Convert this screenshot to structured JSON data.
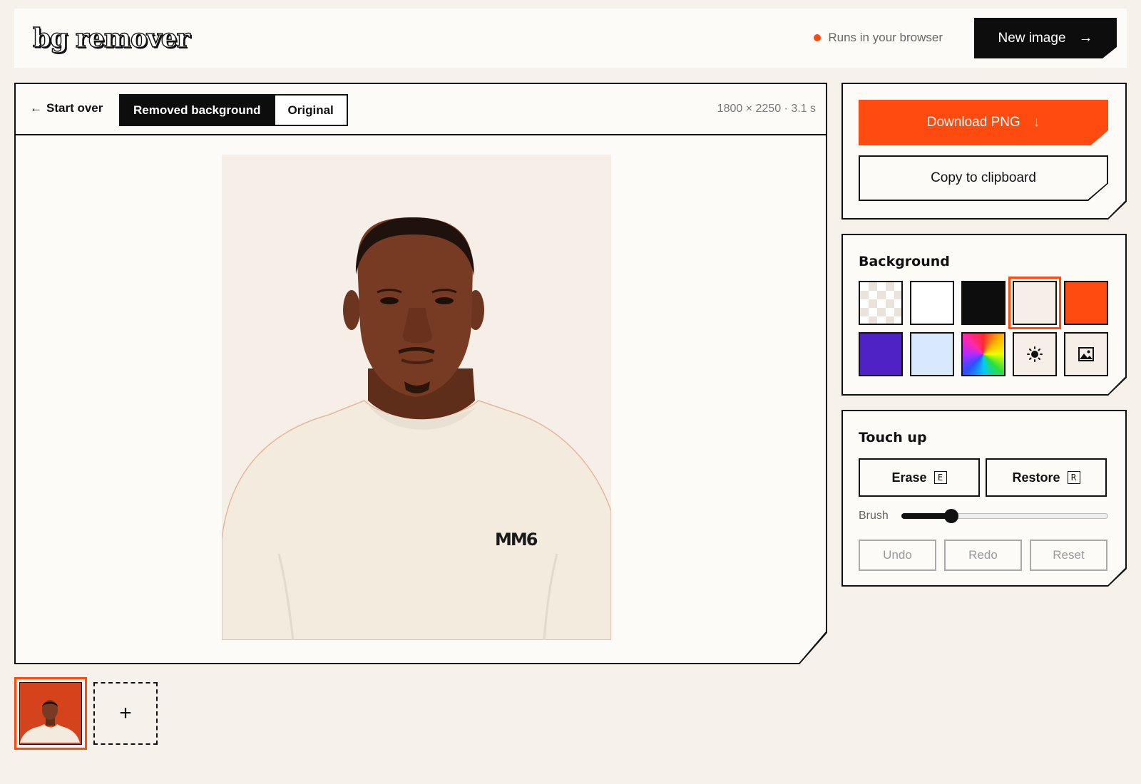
{
  "header": {
    "logo": "bg remover",
    "status": "Runs in your browser",
    "new_image_label": "New image",
    "new_image_arrow": "→"
  },
  "editor": {
    "start_over_arrow": "←",
    "start_over_label": "Start over",
    "tabs": [
      {
        "label": "Removed background",
        "active": true
      },
      {
        "label": "Original",
        "active": false
      }
    ],
    "meta": "1800 × 2250 · 3.1 s",
    "canvas_background": "#f6efe8"
  },
  "actions": {
    "download_label": "Download PNG",
    "download_arrow": "↓",
    "copy_label": "Copy to clipboard",
    "accent_color": "#ff4a10"
  },
  "background_panel": {
    "title": "Background",
    "swatches": [
      {
        "name": "transparent",
        "color": "checker"
      },
      {
        "name": "white",
        "color": "#ffffff"
      },
      {
        "name": "black",
        "color": "#0d0d0d"
      },
      {
        "name": "cream",
        "color": "#f6efe8",
        "selected": true
      },
      {
        "name": "orange",
        "color": "#ff4a10"
      },
      {
        "name": "purple",
        "color": "#4f22c6"
      },
      {
        "name": "light-blue",
        "color": "#d9e9fd"
      },
      {
        "name": "rainbow",
        "color": "gradient"
      },
      {
        "name": "custom-color",
        "icon": "sun-icon"
      },
      {
        "name": "custom-image",
        "icon": "image-icon"
      }
    ]
  },
  "touch_up": {
    "title": "Touch up",
    "erase_label": "Erase",
    "erase_key": "E",
    "restore_label": "Restore",
    "restore_key": "R",
    "brush_label": "Brush",
    "brush_value": 0.24,
    "undo_label": "Undo",
    "redo_label": "Redo",
    "reset_label": "Reset"
  },
  "thumbnails": {
    "add_label": "+"
  }
}
